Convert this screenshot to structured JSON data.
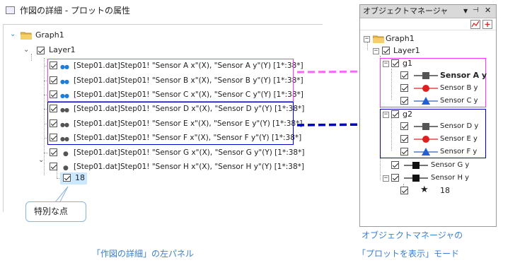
{
  "left_panel": {
    "window_title": "作図の詳細 - プロットの属性",
    "root_label": "Graph1",
    "layer_label": "Layer1",
    "rows": [
      {
        "label": "[Step01.dat]Step01! \"Sensor A x\"(X), \"Sensor A y\"(Y) [1*:38*]",
        "icon": "group-icon"
      },
      {
        "label": "[Step01.dat]Step01! \"Sensor B x\"(X), \"Sensor B y\"(Y) [1*:38*]",
        "icon": "group-icon"
      },
      {
        "label": "[Step01.dat]Step01! \"Sensor C x\"(X), \"Sensor C y\"(Y) [1*:38*]",
        "icon": "group-icon"
      },
      {
        "label": "[Step01.dat]Step01! \"Sensor D x\"(X), \"Sensor D y\"(Y) [1*:38*]",
        "icon": "group-icon"
      },
      {
        "label": "[Step01.dat]Step01! \"Sensor E x\"(X), \"Sensor E y\"(Y) [1*:38*]",
        "icon": "group-icon"
      },
      {
        "label": "[Step01.dat]Step01! \"Sensor F x\"(X), \"Sensor F y\"(Y) [1*:38*]",
        "icon": "group-icon"
      },
      {
        "label": "[Step01.dat]Step01! \"Sensor G x\"(X), \"Sensor G y\"(Y) [1*:38*]",
        "icon": "person-icon"
      },
      {
        "label": "[Step01.dat]Step01! \"Sensor H x\"(X), \"Sensor H y\"(Y) [1*:38*]",
        "icon": "person-icon"
      }
    ],
    "special_point_label": "18",
    "callout_text": "特別な点",
    "caption": "「作図の詳細」の左パネル"
  },
  "right_panel": {
    "title": "オブジェクトマネージャ",
    "root_label": "Graph1",
    "layer_label": "Layer1",
    "group1_label": "g1",
    "group2_label": "g2",
    "g1_items": [
      "Sensor A y",
      "Sensor B y",
      "Sensor C y"
    ],
    "g2_items": [
      "Sensor D y",
      "Sensor E y",
      "Sensor F y"
    ],
    "loose_items": [
      "Sensor G y",
      "Sensor H y"
    ],
    "point_label": "18",
    "caption_line1": "オブジェクトマネージャの",
    "caption_line2": "「プロットを表示」モード"
  },
  "colors": {
    "magenta": "#ff33ff",
    "blue": "#0000cc",
    "caption": "#3a7fd0",
    "series_red": "#e02020",
    "series_blue": "#2060d0",
    "series_gray": "#555555"
  }
}
